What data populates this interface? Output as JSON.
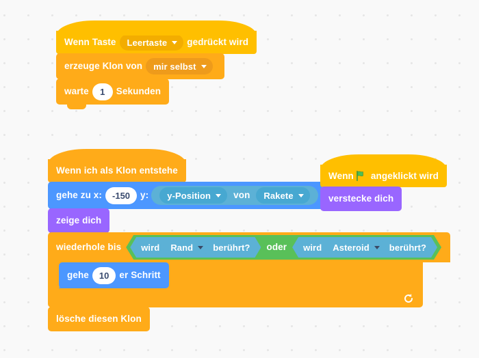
{
  "workspace": {
    "background_color": "#f9f9f9",
    "grid_dot_color": "#e6e6e6"
  },
  "palette": {
    "events": "#ffbf00",
    "control": "#ffab19",
    "motion": "#4c97ff",
    "looks": "#9966ff",
    "sensing": "#5cb1d6",
    "operators": "#59c059"
  },
  "scripts": [
    {
      "id": "script-key-pressed",
      "blocks": {
        "hat": {
          "pre": "Wenn Taste",
          "dropdown": "Leertaste",
          "post": "gedrückt wird"
        },
        "create_clone": {
          "pre": "erzeuge Klon von",
          "dropdown": "mir selbst"
        },
        "wait": {
          "pre": "warte",
          "value": "1",
          "post": "Sekunden"
        }
      }
    },
    {
      "id": "script-when-clone-starts",
      "blocks": {
        "hat": {
          "label": "Wenn ich als Klon entstehe"
        },
        "goto_xy": {
          "pre": "gehe zu x:",
          "x_value": "-150",
          "mid": "y:",
          "reporter": {
            "property": "y-Position",
            "of": "von",
            "target": "Rakete"
          }
        },
        "show": {
          "label": "zeige dich"
        },
        "repeat_until": {
          "label": "wiederhole bis",
          "condition": {
            "operator": "oder",
            "left": {
              "pre": "wird",
              "dropdown": "Rand",
              "post": "berührt?"
            },
            "right": {
              "pre": "wird",
              "dropdown": "Asteroid",
              "post": "berührt?"
            }
          },
          "body": {
            "move_steps": {
              "pre": "gehe",
              "value": "10",
              "post": "er Schritt"
            }
          },
          "loop_icon": "loop-arrow-icon"
        },
        "delete_clone": {
          "label": "lösche diesen Klon"
        }
      }
    },
    {
      "id": "script-when-flag-clicked",
      "blocks": {
        "hat": {
          "pre": "Wenn",
          "icon": "green-flag-icon",
          "post": "angeklickt wird"
        },
        "hide": {
          "label": "verstecke dich"
        }
      }
    }
  ]
}
